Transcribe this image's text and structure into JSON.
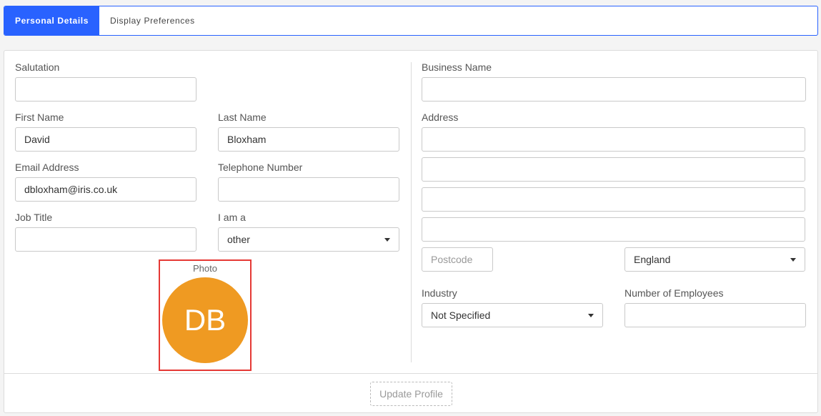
{
  "tabs": [
    {
      "label": "Personal Details",
      "active": true
    },
    {
      "label": "Display Preferences",
      "active": false
    }
  ],
  "personal": {
    "salutation": {
      "label": "Salutation",
      "value": ""
    },
    "first_name": {
      "label": "First Name",
      "value": "David"
    },
    "last_name": {
      "label": "Last Name",
      "value": "Bloxham"
    },
    "email": {
      "label": "Email Address",
      "value": "dbloxham@iris.co.uk"
    },
    "telephone": {
      "label": "Telephone Number",
      "value": ""
    },
    "job_title": {
      "label": "Job Title",
      "value": ""
    },
    "i_am_a": {
      "label": "I am a",
      "value": "other"
    },
    "photo": {
      "label": "Photo",
      "initials": "DB"
    }
  },
  "business": {
    "business_name": {
      "label": "Business Name",
      "value": ""
    },
    "address": {
      "label": "Address",
      "lines": [
        "",
        "",
        "",
        ""
      ]
    },
    "postcode": {
      "placeholder": "Postcode",
      "value": ""
    },
    "country": {
      "value": "England"
    },
    "industry": {
      "label": "Industry",
      "value": "Not Specified"
    },
    "employees": {
      "label": "Number of Employees",
      "value": ""
    }
  },
  "footer": {
    "update_label": "Update Profile"
  },
  "colors": {
    "accent": "#2962ff",
    "avatar": "#ef9a22",
    "highlight": "#e53935"
  }
}
